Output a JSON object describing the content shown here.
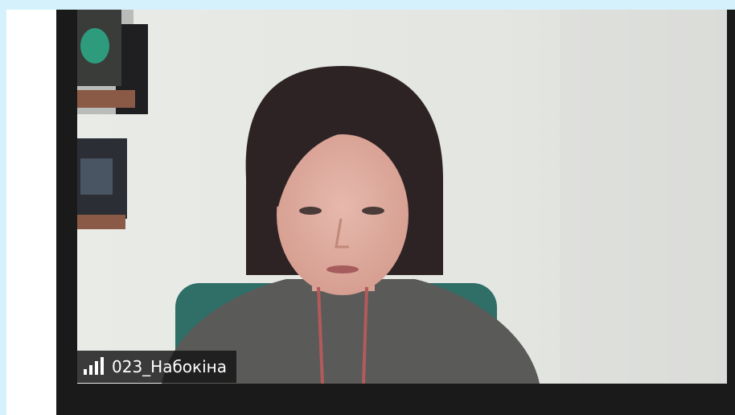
{
  "participant": {
    "name": "023_Набокіна"
  },
  "icons": {
    "signal": "network-signal-icon"
  },
  "colors": {
    "page_background": "#d4f1fc",
    "meeting_background": "#1a1a1a",
    "name_tag_background": "#141414",
    "name_tag_text": "#ffffff"
  }
}
